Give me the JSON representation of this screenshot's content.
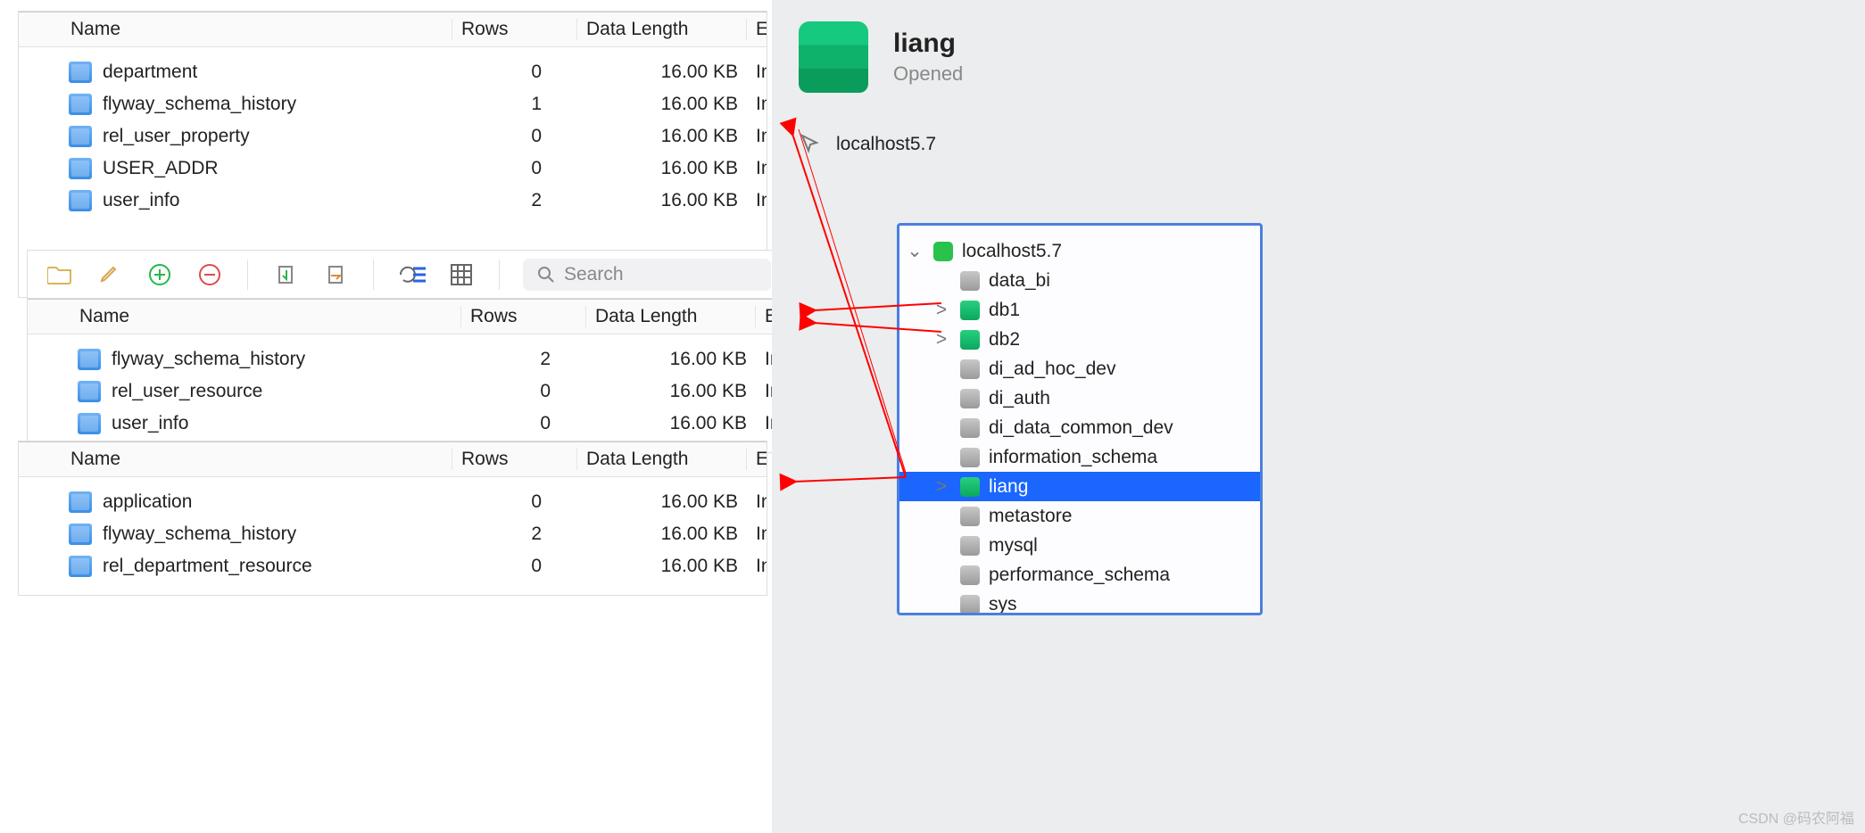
{
  "columns": {
    "name": "Name",
    "rows": "Rows",
    "data_length": "Data Length",
    "engine_short": "Eng",
    "engine": "Engin"
  },
  "panel1": {
    "rows": [
      {
        "name": "department",
        "rows": "0",
        "len": "16.00 KB",
        "engine": "Inn"
      },
      {
        "name": "flyway_schema_history",
        "rows": "1",
        "len": "16.00 KB",
        "engine": "Inn"
      },
      {
        "name": "rel_user_property",
        "rows": "0",
        "len": "16.00 KB",
        "engine": "Inn"
      },
      {
        "name": "USER_ADDR",
        "rows": "0",
        "len": "16.00 KB",
        "engine": "Inn"
      },
      {
        "name": "user_info",
        "rows": "2",
        "len": "16.00 KB",
        "engine": "Inn"
      }
    ]
  },
  "panel2": {
    "rows": [
      {
        "name": "flyway_schema_history",
        "rows": "2",
        "len": "16.00 KB",
        "engine": "Innol"
      },
      {
        "name": "rel_user_resource",
        "rows": "0",
        "len": "16.00 KB",
        "engine": "Innol"
      },
      {
        "name": "user_info",
        "rows": "0",
        "len": "16.00 KB",
        "engine": "Innol"
      }
    ]
  },
  "panel3": {
    "rows": [
      {
        "name": "application",
        "rows": "0",
        "len": "16.00 KB",
        "engine": "Inn"
      },
      {
        "name": "flyway_schema_history",
        "rows": "2",
        "len": "16.00 KB",
        "engine": "Inn"
      },
      {
        "name": "rel_department_resource",
        "rows": "0",
        "len": "16.00 KB",
        "engine": "Inn"
      }
    ]
  },
  "toolbar": {
    "search_placeholder": "Search"
  },
  "right": {
    "title": "liang",
    "status": "Opened",
    "host_label": "localhost5.7"
  },
  "tree": {
    "host": "localhost5.7",
    "items": [
      {
        "name": "data_bi",
        "color": "gray",
        "expand": ""
      },
      {
        "name": "db1",
        "color": "green",
        "expand": ">"
      },
      {
        "name": "db2",
        "color": "green",
        "expand": ">"
      },
      {
        "name": "di_ad_hoc_dev",
        "color": "gray",
        "expand": ""
      },
      {
        "name": "di_auth",
        "color": "gray",
        "expand": ""
      },
      {
        "name": "di_data_common_dev",
        "color": "gray",
        "expand": ""
      },
      {
        "name": "information_schema",
        "color": "gray",
        "expand": ""
      },
      {
        "name": "liang",
        "color": "green",
        "expand": ">",
        "selected": true
      },
      {
        "name": "metastore",
        "color": "gray",
        "expand": ""
      },
      {
        "name": "mysql",
        "color": "gray",
        "expand": ""
      },
      {
        "name": "performance_schema",
        "color": "gray",
        "expand": ""
      },
      {
        "name": "sys",
        "color": "gray",
        "expand": ""
      }
    ]
  },
  "watermark": "CSDN @码农阿福"
}
